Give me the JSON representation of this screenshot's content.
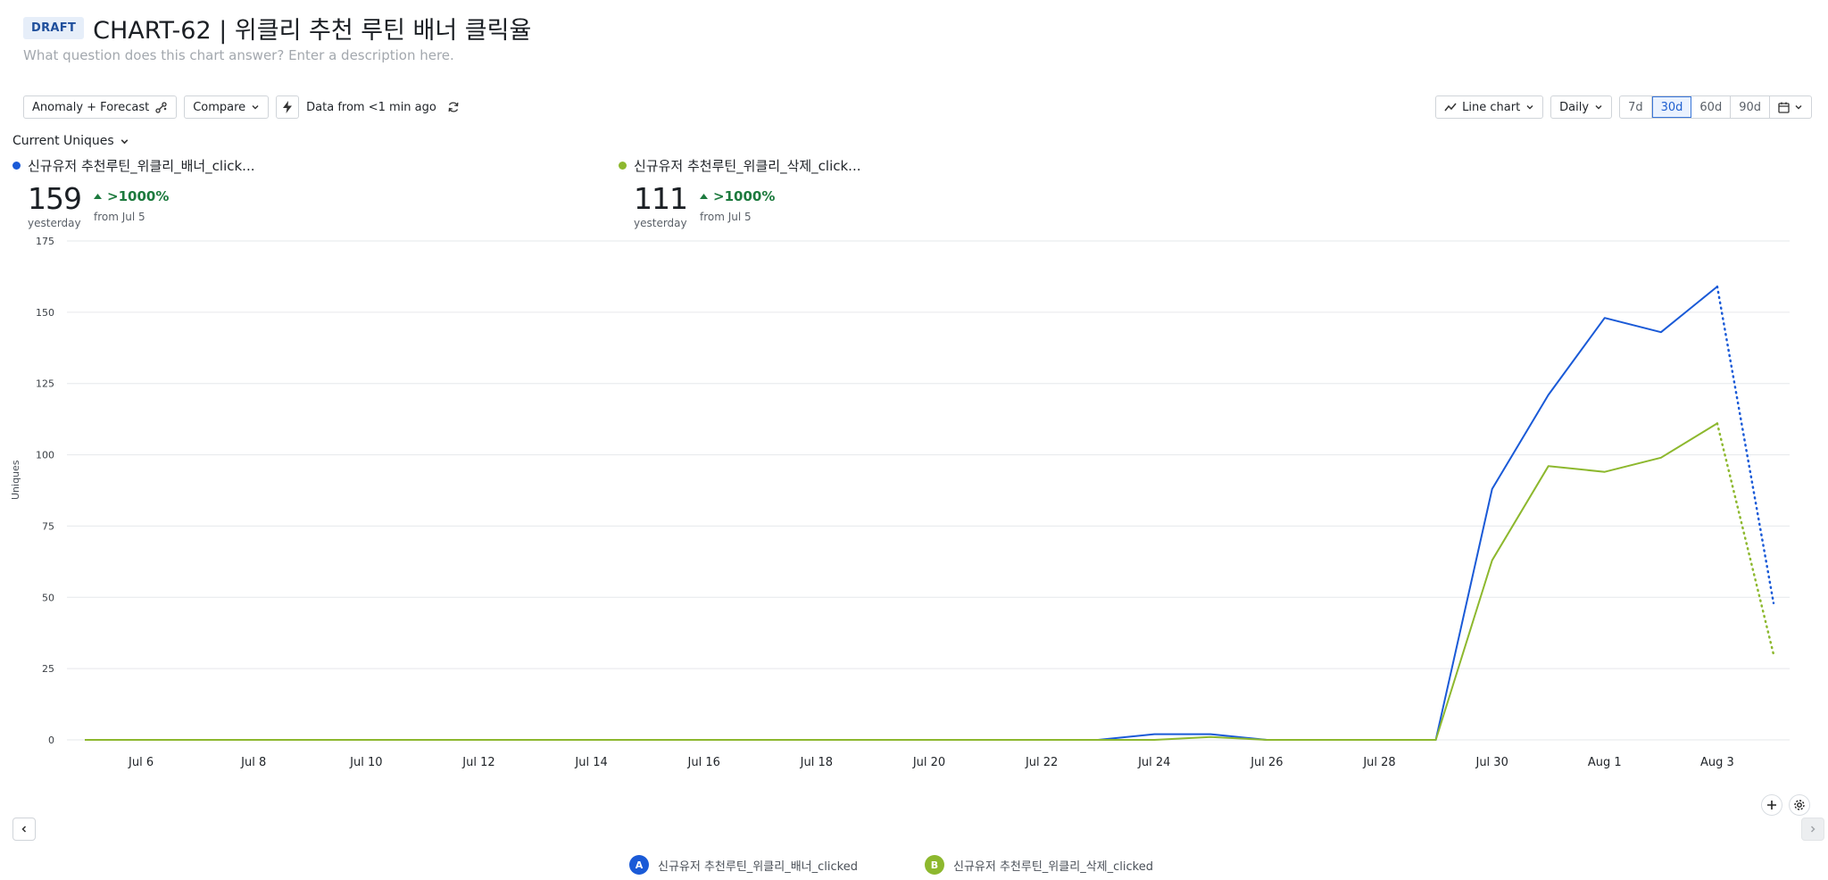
{
  "header": {
    "badge": "DRAFT",
    "title": "CHART-62 | 위클리 추천 루틴 배너 클릭율",
    "description_placeholder": "What question does this chart answer? Enter a description here."
  },
  "toolbar": {
    "anomaly_label": "Anomaly + Forecast",
    "compare_label": "Compare",
    "data_freshness": "Data from <1 min ago",
    "chart_type_label": "Line chart",
    "interval_label": "Daily",
    "ranges": [
      "7d",
      "30d",
      "60d",
      "90d"
    ],
    "active_range": "30d"
  },
  "metric": {
    "label": "Current Uniques"
  },
  "series_cards": [
    {
      "name": "신규유저 추천루틴_위클리_배너_click...",
      "value": "159",
      "sublabel": "yesterday",
      "delta": ">1000%",
      "delta_from": "from Jul 5",
      "color": "#1a5ad7"
    },
    {
      "name": "신규유저 추천루틴_위클리_삭제_click...",
      "value": "111",
      "sublabel": "yesterday",
      "delta": ">1000%",
      "delta_from": "from Jul 5",
      "color": "#8db82e"
    }
  ],
  "legend": [
    {
      "badge": "A",
      "label": "신규유저 추천루틴_위클리_배너_clicked",
      "color": "#1a5ad7"
    },
    {
      "badge": "B",
      "label": "신규유저 추천루틴_위클리_삭제_clicked",
      "color": "#8db82e"
    }
  ],
  "chart_data": {
    "type": "line",
    "ylabel": "Uniques",
    "ylim": [
      0,
      175
    ],
    "yticks": [
      0,
      25,
      50,
      75,
      100,
      125,
      150,
      175
    ],
    "grid": true,
    "x": [
      "Jul 5",
      "Jul 6",
      "Jul 7",
      "Jul 8",
      "Jul 9",
      "Jul 10",
      "Jul 11",
      "Jul 12",
      "Jul 13",
      "Jul 14",
      "Jul 15",
      "Jul 16",
      "Jul 17",
      "Jul 18",
      "Jul 19",
      "Jul 20",
      "Jul 21",
      "Jul 22",
      "Jul 23",
      "Jul 24",
      "Jul 25",
      "Jul 26",
      "Jul 27",
      "Jul 28",
      "Jul 29",
      "Jul 30",
      "Jul 31",
      "Aug 1",
      "Aug 2",
      "Aug 3",
      "Aug 4"
    ],
    "xtick_labels": [
      "Jul 6",
      "Jul 8",
      "Jul 10",
      "Jul 12",
      "Jul 14",
      "Jul 16",
      "Jul 18",
      "Jul 20",
      "Jul 22",
      "Jul 24",
      "Jul 26",
      "Jul 28",
      "Jul 30",
      "Aug 1",
      "Aug 3"
    ],
    "series": [
      {
        "name": "신규유저 추천루틴_위클리_배너_clicked",
        "color": "#1a5ad7",
        "values": [
          0,
          0,
          0,
          0,
          0,
          0,
          0,
          0,
          0,
          0,
          0,
          0,
          0,
          0,
          0,
          0,
          0,
          0,
          0,
          2,
          2,
          0,
          0,
          0,
          0,
          88,
          121,
          148,
          143,
          159,
          48
        ],
        "incomplete_from": "Aug 3"
      },
      {
        "name": "신규유저 추천루틴_위클리_삭제_clicked",
        "color": "#8db82e",
        "values": [
          0,
          0,
          0,
          0,
          0,
          0,
          0,
          0,
          0,
          0,
          0,
          0,
          0,
          0,
          0,
          0,
          0,
          0,
          0,
          0,
          1,
          0,
          0,
          0,
          0,
          63,
          96,
          94,
          99,
          111,
          30
        ],
        "incomplete_from": "Aug 3"
      }
    ]
  }
}
